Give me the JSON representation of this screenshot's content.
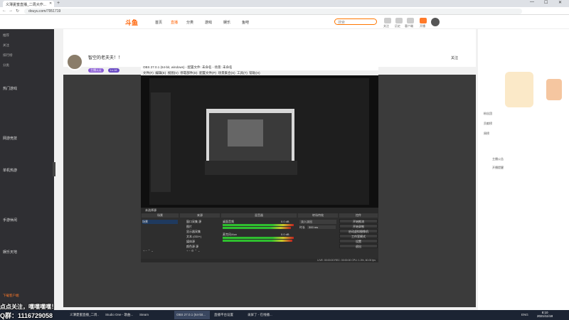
{
  "browser": {
    "tab_title": "义薄夏蜜直播_二周大作...",
    "url": "douyu.com/7951719",
    "back": "←",
    "forward": "→",
    "reload": "↻"
  },
  "site": {
    "logo": "斗鱼",
    "nav": [
      "首页",
      "直播",
      "分类",
      "游戏",
      "娱乐",
      "鱼吧"
    ],
    "search_placeholder": "搜索",
    "header_icons": [
      "关注",
      "历史",
      "客户端",
      "开播",
      "消息"
    ]
  },
  "sidebar": {
    "top_items": [
      "推荐",
      "关注",
      "排行榜",
      "分类"
    ],
    "sections": [
      "热门游戏",
      "网游竞技",
      "单机热游",
      "手游休闲",
      "娱乐天地"
    ],
    "bottom": "下载客户端"
  },
  "streamer": {
    "title": "智空的老夫夫！！",
    "badges": [
      "主播认证",
      "Lv.18"
    ],
    "follow": "关注"
  },
  "obs": {
    "title": "OBS 27.0.1 (64-bit, windows) - 配置文件: 未命名 - 场景: 未命名",
    "menu": [
      "文件(F)",
      "编辑(E)",
      "视图(V)",
      "停靠部件(D)",
      "配置文件(P)",
      "场景集合(S)",
      "工具(T)",
      "帮助(H)"
    ],
    "scene_bar": "未选择源",
    "docks": {
      "scenes": "场景",
      "sources": "来源",
      "mixer": "混音器",
      "transitions": "转场特效",
      "controls": "控件"
    },
    "scene_items": [
      "场景"
    ],
    "source_items": [
      "窗口采集 源",
      "图片",
      "显示器采集",
      "文本 (GDI+)",
      "媒体源",
      "颜色源 源"
    ],
    "mixer_items": [
      {
        "name": "桌面音频",
        "db": "0.0 dB"
      },
      {
        "name": "麦克风/Aux",
        "db": "0.0 dB"
      }
    ],
    "transition": "淡入淡出",
    "duration_label": "时长",
    "duration": "300 ms",
    "controls": [
      "开始推流",
      "开始录制",
      "启动虚拟摄像机",
      "工作室模式",
      "设置",
      "退出"
    ],
    "status": "LIVE: 00:00:00   REC: 00:00:00   CPU: 1.3%, 60.00 fps"
  },
  "right_panel": {
    "text_lines": [
      "粉丝团",
      "贡献榜",
      "周榜",
      "主播公告",
      "开播提醒"
    ]
  },
  "overlay": {
    "line1": "点点关注，嘿嘿嘿嘿！",
    "line2": "Q群：1116729058"
  },
  "taskbar": {
    "apps": [
      "义薄夏蜜直播_二周...",
      "Studio One - 歌曲...",
      "Steam",
      "OBS 27.0.1 (64-bit...",
      "直播平台设置",
      "录屏了 - 在线播..."
    ],
    "clock_time": "8:10",
    "clock_date": "2021/11/18",
    "lang": "ENG"
  },
  "colors": {
    "accent": "#ff6000",
    "sidebar_bg": "#2f2f33",
    "obs_bg": "#2e2e2e",
    "taskbar_bg": "#1c2433"
  }
}
